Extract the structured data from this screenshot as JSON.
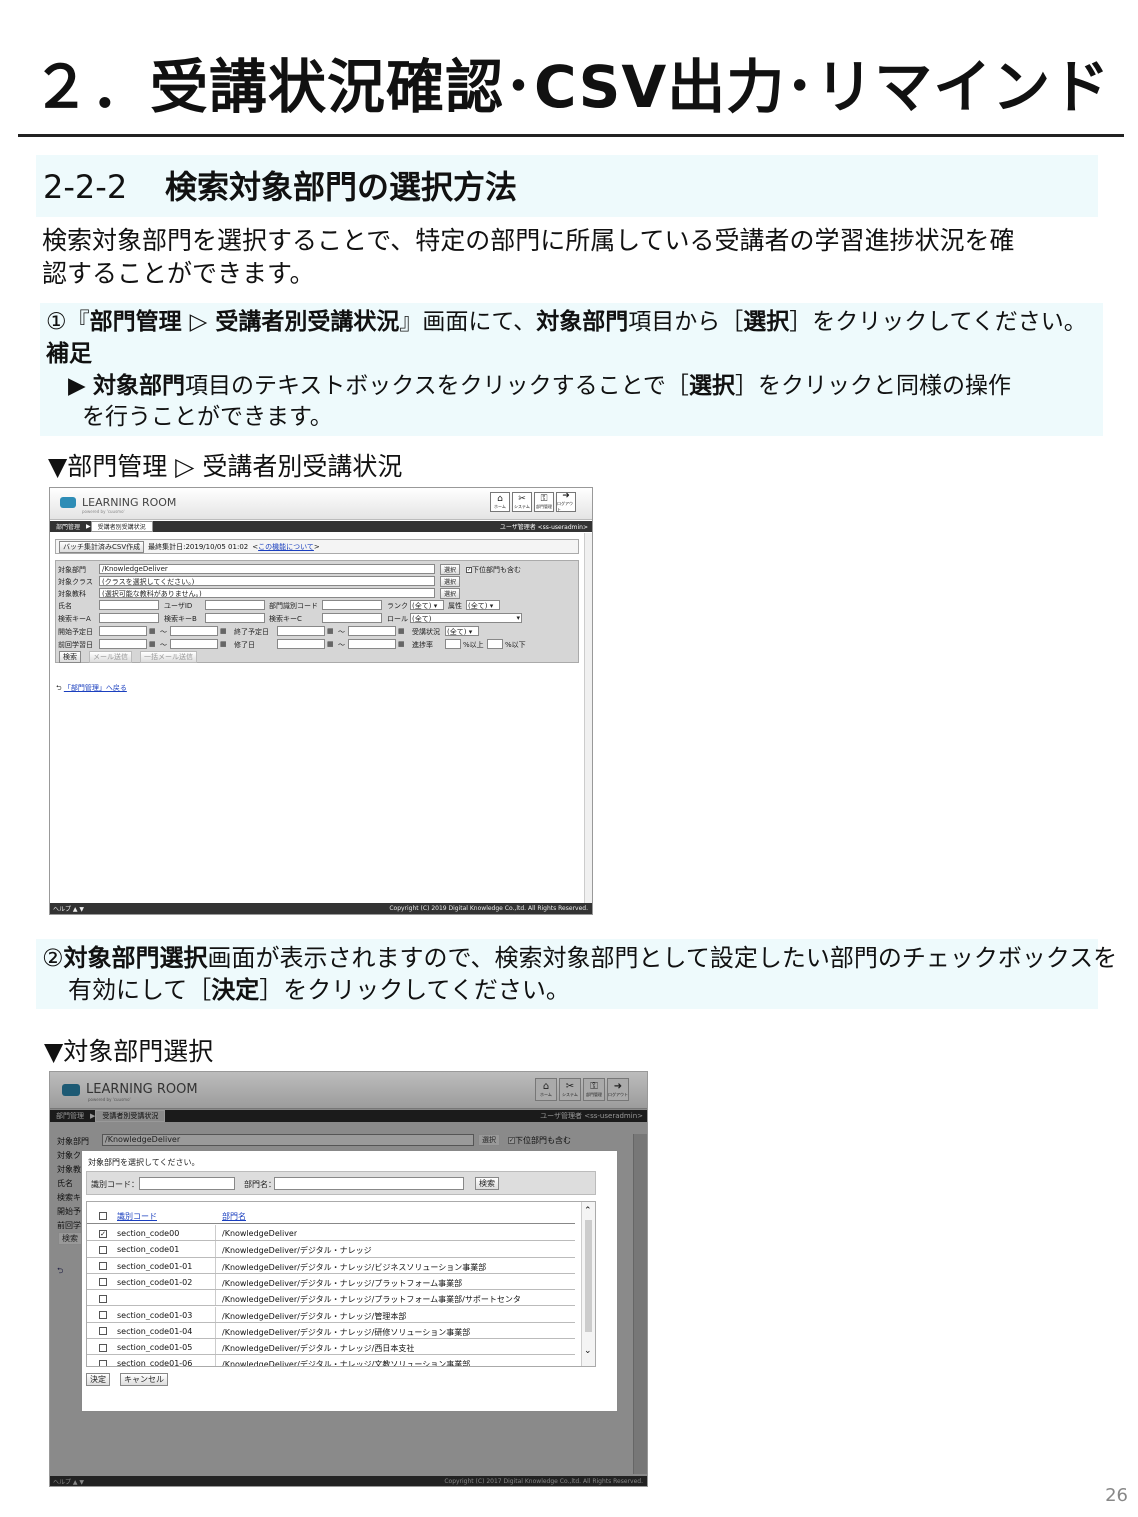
{
  "slide": {
    "title": "２．受講状況確認･CSV出力･リマインド",
    "section_number": "2-2-2",
    "section_title": "検索対象部門の選択方法",
    "intro_lines": [
      "検索対象部門を選択することで、特定の部門に所属している受講者の学習進捗状況を確",
      "認することができます。"
    ],
    "step1": {
      "parts": [
        "①『",
        "部門管理 ▷ 受講者別受講状況",
        "』画面にて、",
        "対象部門",
        "項目から［",
        "選択",
        "］をクリックしてください。"
      ],
      "hint_label": "補足",
      "hint_parts": [
        "▶ ",
        "対象部門",
        "項目のテキストボックスをクリックすることで［",
        "選択",
        "］をクリックと同様の操作"
      ],
      "hint_line2": "を行うことができます。"
    },
    "caption1": "▼部門管理 ▷ 受講者別受講状況",
    "step2": {
      "parts": [
        "②",
        "対象部門選択",
        "画面が表示されますので、検索対象部門として設定したい部門のチェックボックスを"
      ],
      "line2_parts": [
        "有効にして［",
        "決定",
        "］をクリックしてください。"
      ]
    },
    "caption2": "▼対象部門選択",
    "page_number": "26"
  },
  "app": {
    "logo_text": "LEARNING ROOM",
    "logo_sub": "powered by 'cuusmo'",
    "icon_buttons": [
      "ホーム",
      "システム",
      "部門管理",
      "ログアウト"
    ],
    "breadcrumb": [
      "部門管理",
      "受講者別受講状況"
    ],
    "user_label": "ユーザ管理者 <ss-useradmin>",
    "footer_left": "ヘルプ ▲ ▼",
    "accent_color": "#2e8db6"
  },
  "screen1": {
    "batch_button": "バッチ集計済みCSV作成",
    "last_aggregated": "最終集計日:2019/10/05 01:02",
    "feature_link": "この機能について",
    "fields": {
      "dept_label": "対象部門",
      "dept_value": "/KnowledgeDeliver",
      "class_label": "対象クラス",
      "class_value": "(クラスを選択してください。)",
      "course_label": "対象教科",
      "course_value": "(選択可能な教科がありません。)",
      "select_btn": "選択",
      "include_sub": "下位部門も含む",
      "name_label": "氏名",
      "userid_label": "ユーザID",
      "deptcode_label": "部門識別コード",
      "rank_label": "ランク",
      "all": "(全て)",
      "attr_label": "属性",
      "keyA_label": "検索キーA",
      "keyB_label": "検索キーB",
      "keyC_label": "検索キーC",
      "role_label": "ロール",
      "start_label": "開始予定日",
      "end_label": "終了予定日",
      "status_label": "受講状況",
      "last_label": "前回学習日",
      "done_label": "修了日",
      "progress_label": "進捗率",
      "above": "%以上",
      "below": "%以下",
      "tilde": "～"
    },
    "buttons": {
      "search": "検索",
      "mail": "メール送信",
      "bulk_mail": "一括メール送信"
    },
    "back_link": "「部門管理」へ戻る",
    "copyright": "Copyright (C) 2019 Digital Knowledge Co.,ltd. All Rights Reserved."
  },
  "screen2": {
    "instruction": "対象部門を選択してください。",
    "code_label": "識別コード：",
    "name_label": "部門名：",
    "search_btn": "検索",
    "col_code": "識別コード",
    "col_name": "部門名",
    "rows": [
      {
        "checked": true,
        "code": "section_code00",
        "name": "/KnowledgeDeliver"
      },
      {
        "checked": false,
        "code": "section_code01",
        "name": "/KnowledgeDeliver/デジタル・ナレッジ"
      },
      {
        "checked": false,
        "code": "section_code01-01",
        "name": "/KnowledgeDeliver/デジタル・ナレッジ/ビジネスソリューション事業部"
      },
      {
        "checked": false,
        "code": "section_code01-02",
        "name": "/KnowledgeDeliver/デジタル・ナレッジ/プラットフォーム事業部"
      },
      {
        "checked": false,
        "code": "",
        "name": "/KnowledgeDeliver/デジタル・ナレッジ/プラットフォーム事業部/サポートセンタ"
      },
      {
        "checked": false,
        "code": "section_code01-03",
        "name": "/KnowledgeDeliver/デジタル・ナレッジ/管理本部"
      },
      {
        "checked": false,
        "code": "section_code01-04",
        "name": "/KnowledgeDeliver/デジタル・ナレッジ/研修ソリューション事業部"
      },
      {
        "checked": false,
        "code": "section_code01-05",
        "name": "/KnowledgeDeliver/デジタル・ナレッジ/西日本支社"
      },
      {
        "checked": false,
        "code": "section_code01-06",
        "name": "/KnowledgeDeliver/デジタル・ナレッジ/文教ソリューション事業部"
      }
    ],
    "ok_btn": "決定",
    "cancel_btn": "キャンセル",
    "bg_dept_label": "対象部門",
    "bg_labels": [
      "対象ク",
      "対象教",
      "氏名",
      "検索キ",
      "開始予",
      "前回学"
    ],
    "bg_search": "検索",
    "copyright": "Copyright (C) 2017 Digital Knowledge Co.,ltd. All Rights Reserved."
  }
}
